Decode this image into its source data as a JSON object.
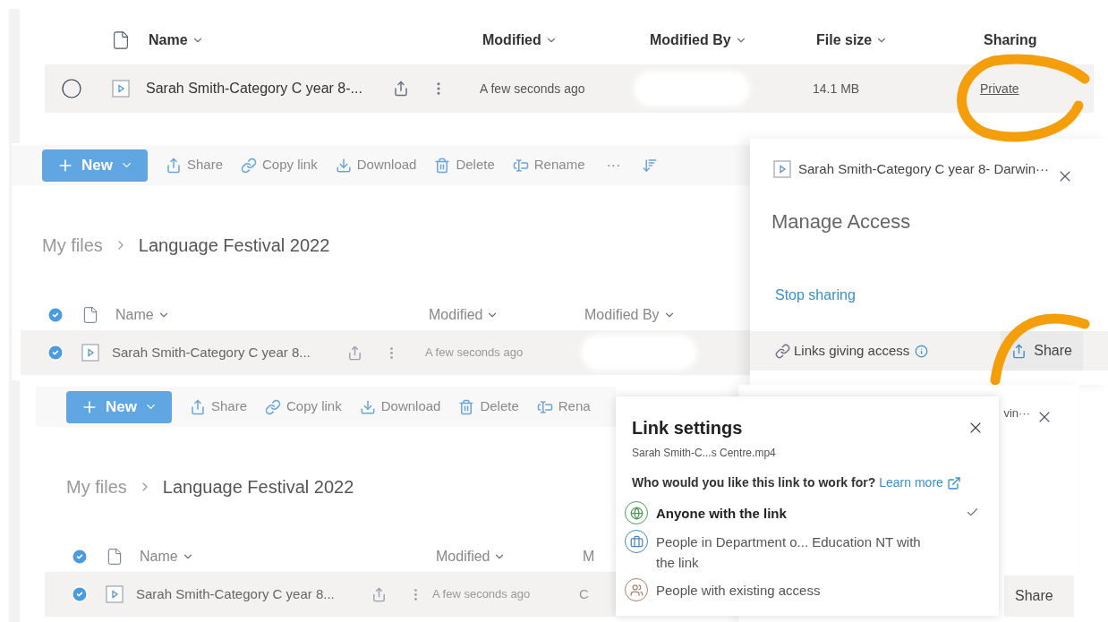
{
  "top_list": {
    "columns": [
      {
        "label": "Name",
        "sortable": true
      },
      {
        "label": "Modified",
        "sortable": true
      },
      {
        "label": "Modified By",
        "sortable": true
      },
      {
        "label": "File size",
        "sortable": true
      },
      {
        "label": "Sharing",
        "sortable": false
      }
    ],
    "row": {
      "selected": false,
      "name": "Sarah Smith-Category C year 8-...",
      "modified": "A few seconds ago",
      "file_size": "14.1 MB",
      "sharing": "Private"
    }
  },
  "middle_view": {
    "toolbar": [
      {
        "kind": "new",
        "label": "New"
      },
      {
        "kind": "share",
        "label": "Share"
      },
      {
        "kind": "copy",
        "label": "Copy link"
      },
      {
        "kind": "download",
        "label": "Download"
      },
      {
        "kind": "delete",
        "label": "Delete"
      },
      {
        "kind": "rename",
        "label": "Rename"
      },
      {
        "kind": "more",
        "label": "···"
      },
      {
        "kind": "sort"
      }
    ],
    "breadcrumb": [
      "My files",
      "Language Festival 2022"
    ],
    "all_selected": true,
    "columns": [
      "Name",
      "Modified",
      "Modified By"
    ],
    "row": {
      "selected": true,
      "name": "Sarah Smith-Category C year 8...",
      "modified": "A few seconds ago"
    }
  },
  "manage_access": {
    "file": "Sarah Smith-Category C year 8- Darwin···",
    "title": "Manage Access",
    "stop_sharing": "Stop sharing",
    "links_label": "Links giving access",
    "share_button": "Share"
  },
  "bottom_view": {
    "toolbar": [
      {
        "kind": "new",
        "label": "New"
      },
      {
        "kind": "share",
        "label": "Share"
      },
      {
        "kind": "copy",
        "label": "Copy link"
      },
      {
        "kind": "download",
        "label": "Download"
      },
      {
        "kind": "delete",
        "label": "Delete"
      },
      {
        "kind": "rename",
        "label": "Rena"
      }
    ],
    "breadcrumb": [
      "My files",
      "Language Festival 2022"
    ],
    "all_selected": true,
    "columns": [
      "Name",
      "Modified",
      "M"
    ],
    "row": {
      "selected": true,
      "name": "Sarah Smith-Category C year 8...",
      "modified": "A few seconds ago",
      "column_3": "C"
    }
  },
  "back_panel": {
    "file_tail": "vin···",
    "share_button": "Share"
  },
  "link_settings": {
    "title": "Link settings",
    "file": "Sarah Smith-C...s Centre.mp4",
    "question": "Who would you like this link to work for?",
    "learn_more": "Learn more",
    "options": [
      {
        "kind": "globe",
        "color": "#4f9a5a",
        "label": "Anyone with the link",
        "selected": true
      },
      {
        "kind": "briefcase",
        "color": "#4a86c0",
        "label": "People in Department o... Education NT with the link",
        "selected": false
      },
      {
        "kind": "people",
        "color": "#a8826a",
        "label": "People with existing access",
        "selected": false
      }
    ]
  }
}
